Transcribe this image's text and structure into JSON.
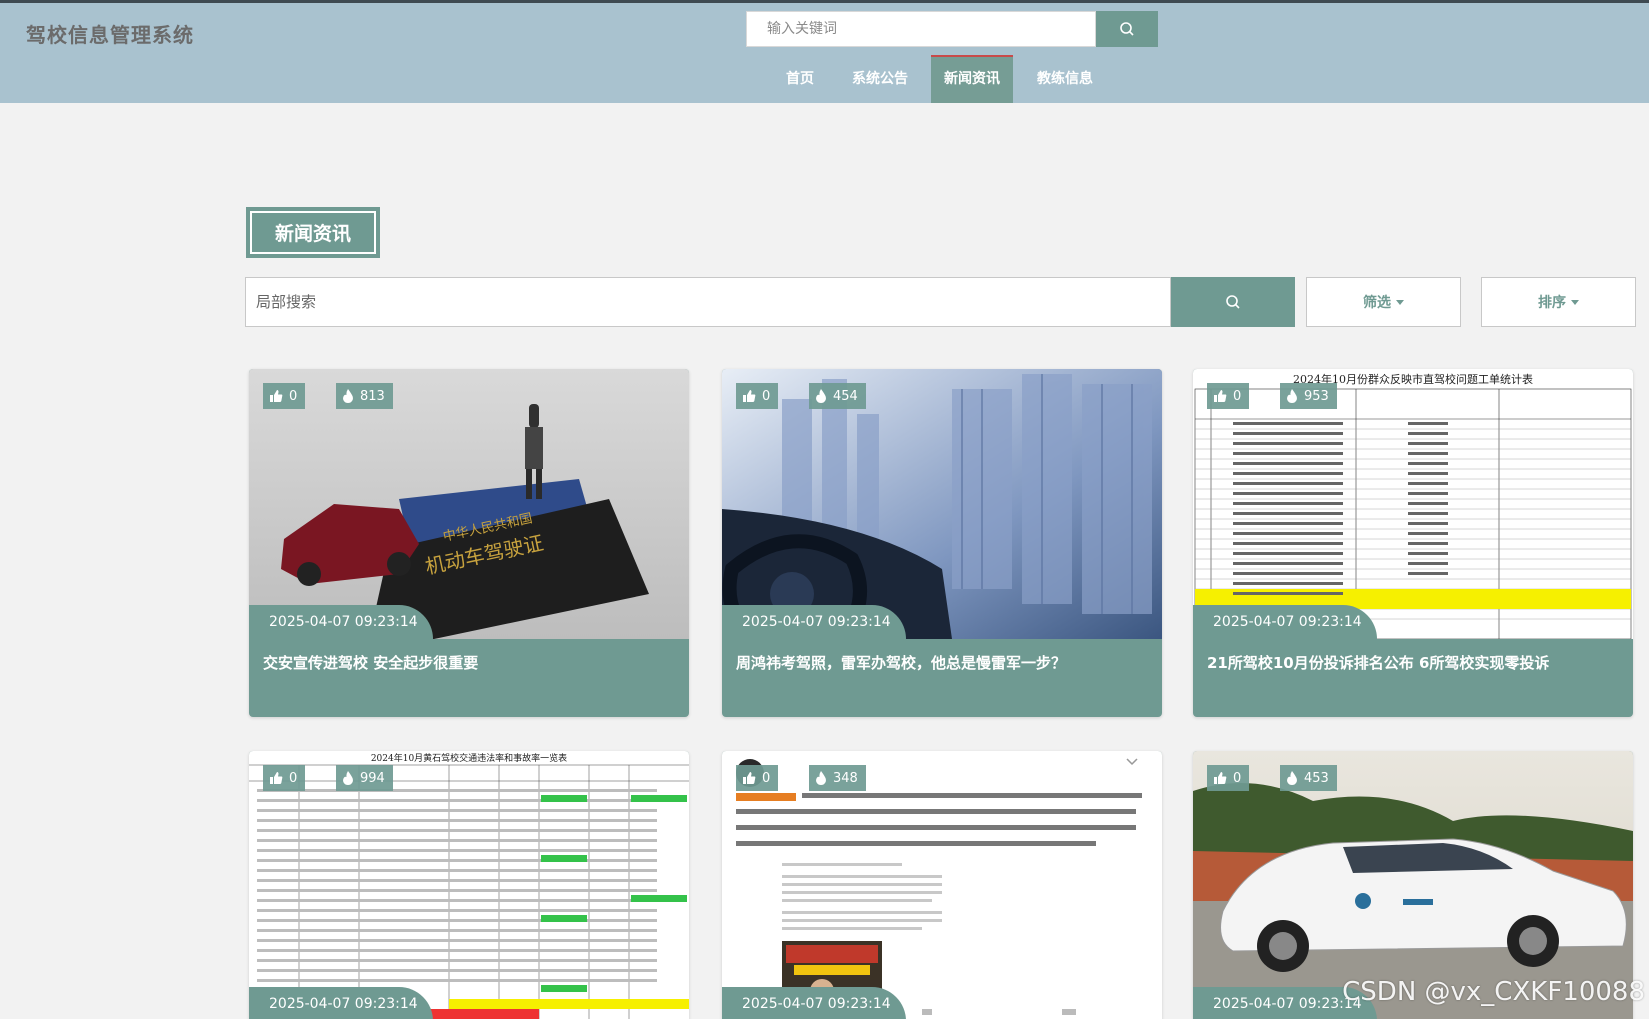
{
  "header": {
    "brand": "驾校信息管理系统",
    "search_placeholder": "输入关键词",
    "nav": [
      {
        "label": "首页",
        "active": false
      },
      {
        "label": "系统公告",
        "active": false
      },
      {
        "label": "新闻资讯",
        "active": true
      },
      {
        "label": "教练信息",
        "active": false
      }
    ]
  },
  "main": {
    "section_title": "新闻资讯",
    "search_placeholder": "局部搜索",
    "filter_label": "筛选",
    "sort_label": "排序"
  },
  "cards": [
    {
      "likes": "0",
      "views": "813",
      "date": "2025-04-07 09:23:14",
      "title": "交安宣传进驾校 安全起步很重要",
      "image": "license-car-photo"
    },
    {
      "likes": "0",
      "views": "454",
      "date": "2025-04-07 09:23:14",
      "title": "周鸿祎考驾照，雷军办驾校，他总是慢雷军一步？",
      "image": "windshield-city-photo"
    },
    {
      "likes": "0",
      "views": "953",
      "date": "2025-04-07 09:23:14",
      "title": "21所驾校10月份投诉排名公布 6所驾校实现零投诉",
      "image": "complaint-table-image",
      "image_title": "2024年10月份群众反映市直驾校问题工单统计表"
    },
    {
      "likes": "0",
      "views": "994",
      "date": "2025-04-07 09:23:14",
      "title": "",
      "image": "traffic-table-image",
      "image_title": "2024年10月黄石驾校交通违法率和事故率一览表"
    },
    {
      "likes": "0",
      "views": "348",
      "date": "2025-04-07 09:23:14",
      "title": "",
      "image": "social-post-image"
    },
    {
      "likes": "0",
      "views": "453",
      "date": "2025-04-07 09:23:14",
      "title": "",
      "image": "training-car-photo"
    }
  ],
  "watermark": "CSDN @vx_CXKF10088",
  "colors": {
    "accent": "#6f9a92",
    "header": "#a9c2cf",
    "active_border": "#c94a4a",
    "background": "#f2f2f2"
  }
}
